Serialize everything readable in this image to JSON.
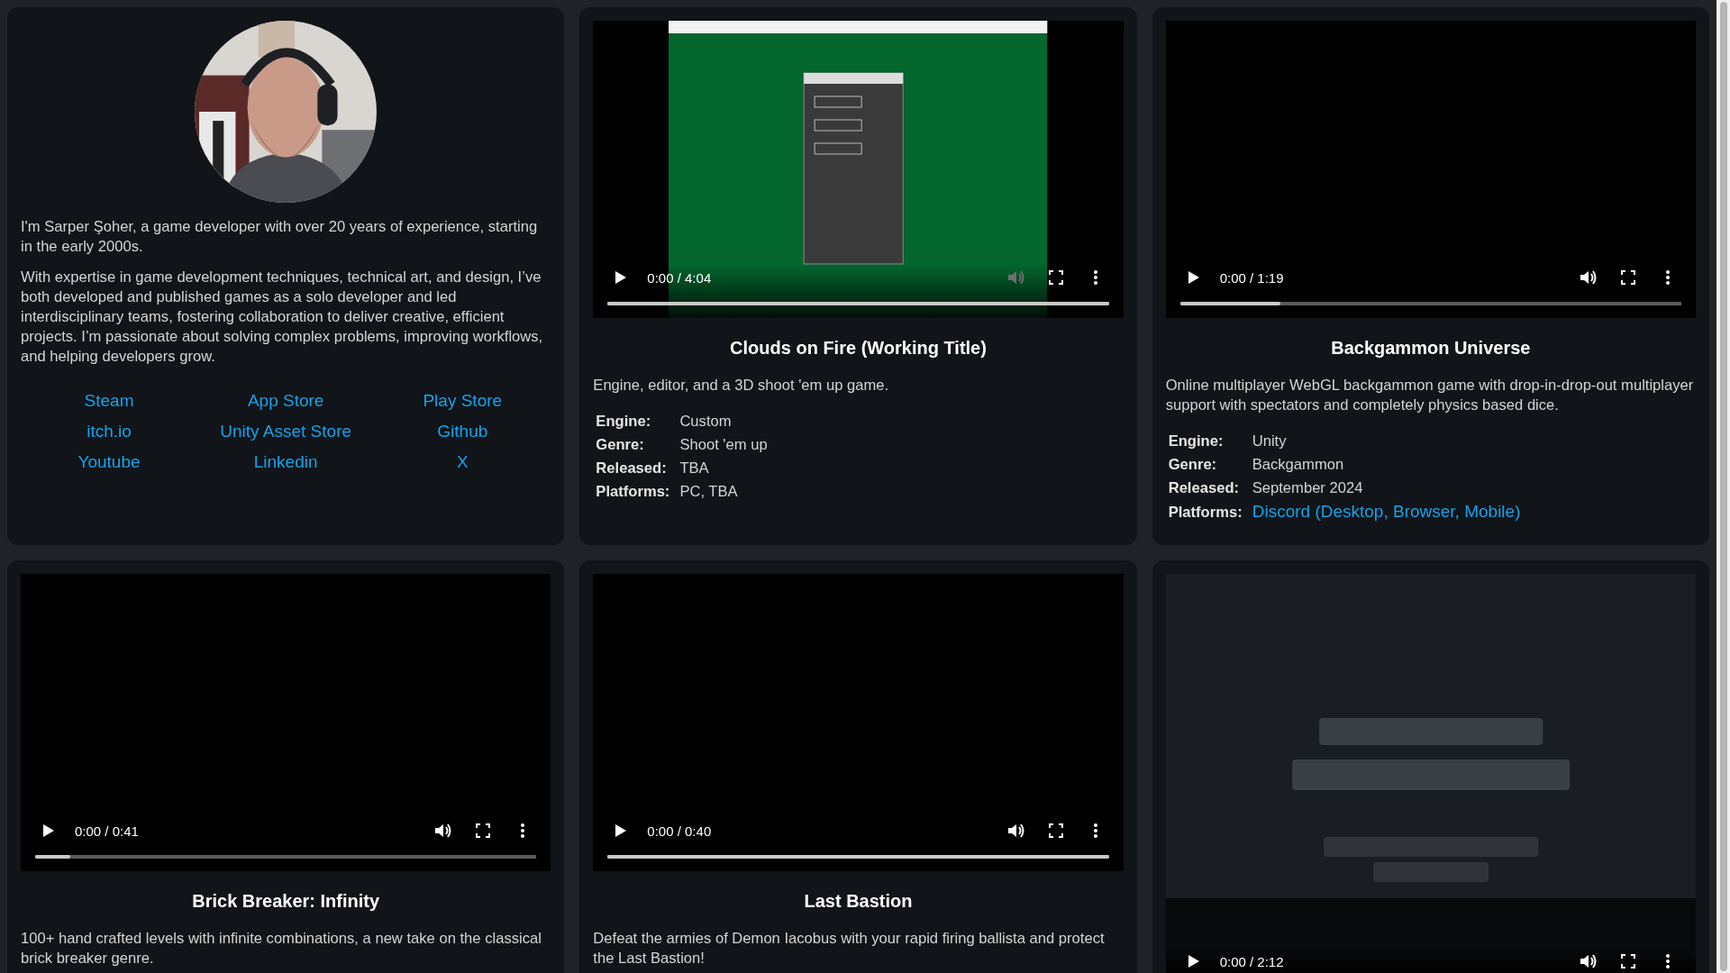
{
  "profile": {
    "paragraphs": [
      "I'm Sarper Şoher, a game developer with over 20 years of experience, starting in the early 2000s.",
      "With expertise in game development techniques, technical art, and design, I’ve both developed and published games as a solo developer and led interdisciplinary teams, fostering collaboration to deliver creative, efficient projects. I’m passionate about solving complex problems, improving workflows, and helping developers grow."
    ],
    "links": [
      "Steam",
      "App Store",
      "Play Store",
      "itch.io",
      "Unity Asset Store",
      "Github",
      "Youtube",
      "Linkedin",
      "X"
    ]
  },
  "projects": [
    {
      "video": {
        "time": "0:00 / 4:04",
        "level": 1,
        "volume_disabled": true
      },
      "title": "Clouds on Fire (Working Title)",
      "description": "Engine, editor, and a 3D shoot 'em up game.",
      "details": [
        {
          "label": "Engine:",
          "value": "Custom",
          "link": false
        },
        {
          "label": "Genre:",
          "value": "Shoot 'em up",
          "link": false
        },
        {
          "label": "Released:",
          "value": "TBA",
          "link": false
        },
        {
          "label": "Platforms:",
          "value": "PC, TBA",
          "link": false
        }
      ]
    },
    {
      "video": {
        "time": "0:00 / 1:19",
        "level": 0.2,
        "volume_disabled": false
      },
      "title": "Backgammon Universe",
      "description": "Online multiplayer WebGL backgammon game with drop-in-drop-out multiplayer support with spectators and completely physics based dice.",
      "details": [
        {
          "label": "Engine:",
          "value": "Unity",
          "link": false
        },
        {
          "label": "Genre:",
          "value": "Backgammon",
          "link": false
        },
        {
          "label": "Released:",
          "value": "September 2024",
          "link": false
        },
        {
          "label": "Platforms:",
          "value": "Discord (Desktop, Browser, Mobile)",
          "link": true
        }
      ]
    },
    {
      "video": {
        "time": "0:00 / 0:41",
        "level": 0.07,
        "volume_disabled": false
      },
      "title": "Brick Breaker: Infinity",
      "description": "100+ hand crafted levels with infinite combinations, a new take on the classical brick breaker genre."
    },
    {
      "video": {
        "time": "0:00 / 0:40",
        "level": 1,
        "volume_disabled": false
      },
      "title": "Last Bastion",
      "description": "Defeat the armies of Demon Iacobus with your rapid firing ballista and protect the Last Bastion!"
    },
    {
      "video": {
        "time": "0:00 / 2:12",
        "volume_disabled": false
      }
    }
  ]
}
